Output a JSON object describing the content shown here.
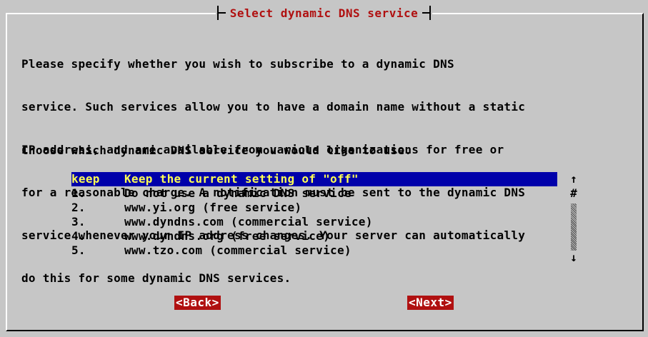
{
  "dialog": {
    "title": "Select dynamic DNS service",
    "description_lines": [
      "Please specify whether you wish to subscribe to a dynamic DNS",
      "service. Such services allow you to have a domain name without a static",
      "IP address, and are available from various organizations for free or",
      "for a reasonable charge. A notification must be sent to the dynamic DNS",
      "service whenever your IP address changes. Your server can automatically",
      "do this for some dynamic DNS services."
    ],
    "prompt": "Choose which dynamic DNS service you would like to use.",
    "options": [
      {
        "tag": "keep",
        "label": "Keep the current setting of \"off\"",
        "selected": true
      },
      {
        "tag": "1.",
        "label": "Do not use a dynamic DNS service",
        "selected": false
      },
      {
        "tag": "2.",
        "label": "www.yi.org (free service)",
        "selected": false
      },
      {
        "tag": "3.",
        "label": "www.dyndns.com (commercial service)",
        "selected": false
      },
      {
        "tag": "4.",
        "label": "www.dyndns.org (free service)",
        "selected": false
      },
      {
        "tag": "5.",
        "label": "www.tzo.com (commercial service)",
        "selected": false
      }
    ],
    "scrollbar": {
      "up_glyph": "↑",
      "position_glyph": "#",
      "down_glyph": "↓"
    },
    "buttons": {
      "back_label": "<Back>",
      "next_label": "<Next>"
    },
    "colors": {
      "background": "#c6c6c6",
      "title": "#b01010",
      "selection_bg": "#0000aa",
      "selection_fg": "#ffff54",
      "button_bg": "#b01010",
      "button_fg": "#ffffff"
    }
  }
}
